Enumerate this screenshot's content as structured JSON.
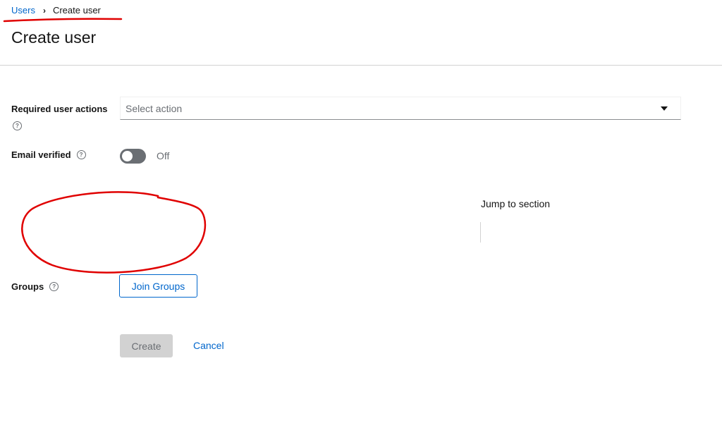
{
  "breadcrumb": {
    "parent": "Users",
    "current": "Create user"
  },
  "page": {
    "title": "Create user"
  },
  "form": {
    "required_actions": {
      "label": "Required user actions",
      "placeholder": "Select action"
    },
    "email_verified": {
      "label": "Email verified",
      "state_text": "Off",
      "checked": false
    },
    "groups": {
      "label": "Groups",
      "button": "Join Groups"
    }
  },
  "jump_to_section": {
    "title": "Jump to section"
  },
  "actions": {
    "create": "Create",
    "cancel": "Cancel"
  },
  "colors": {
    "link": "#0066cc",
    "annotation": "#e00000",
    "disabled_bg": "#d2d2d2",
    "toggle_off": "#6a6e73"
  },
  "icons": {
    "breadcrumb_separator": "chevron-right-icon",
    "help": "question-circle-icon",
    "select_caret": "caret-down-icon"
  }
}
